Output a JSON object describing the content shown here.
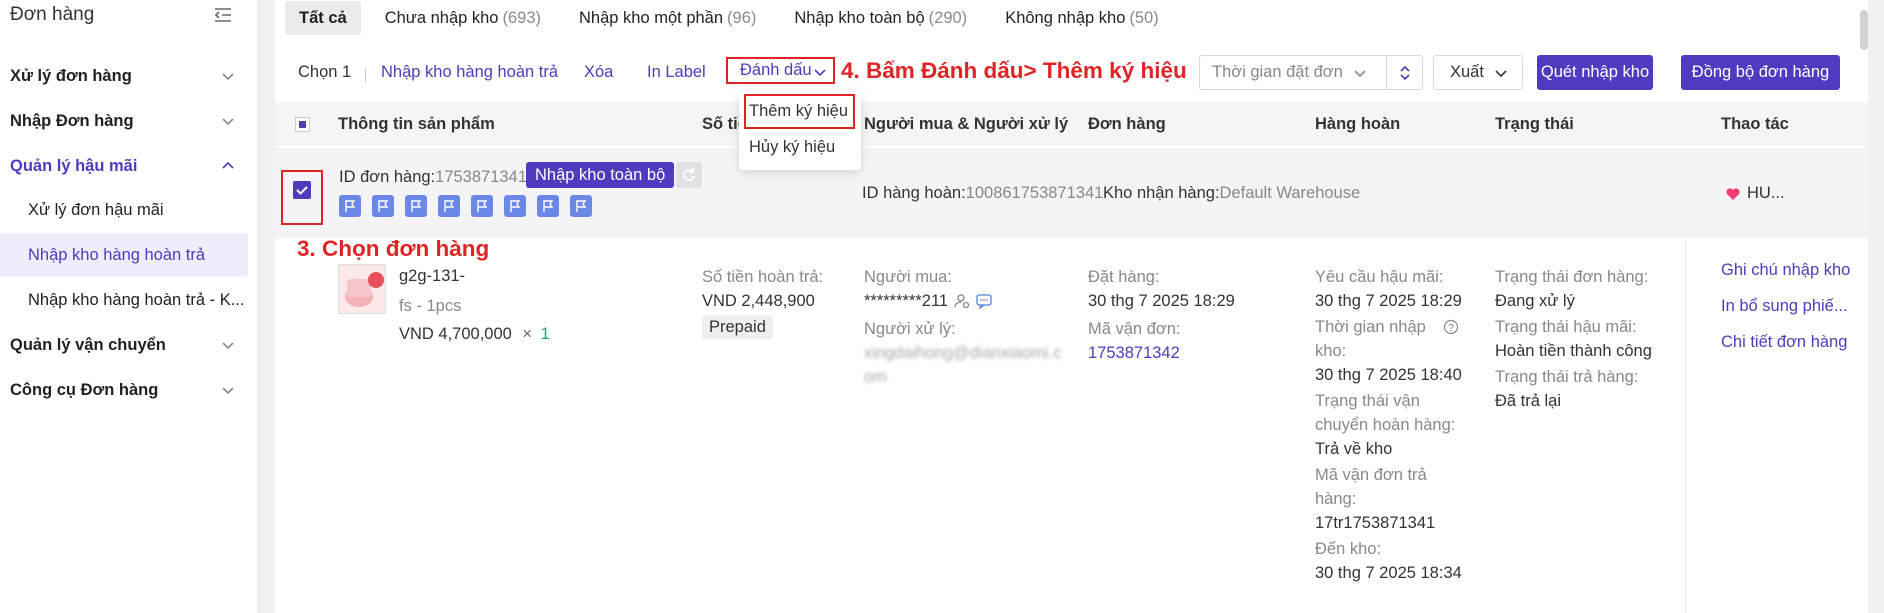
{
  "sidebar": {
    "title": "Đơn hàng",
    "items": [
      {
        "label": "Xử lý đơn hàng"
      },
      {
        "label": "Nhập Đơn hàng"
      },
      {
        "label": "Quản lý hậu mãi"
      },
      {
        "label": "Quản lý vận chuyển"
      },
      {
        "label": "Công cụ Đơn hàng"
      }
    ],
    "subitems": [
      {
        "label": "Xử lý đơn hậu mãi"
      },
      {
        "label": "Nhập kho hàng hoàn trả"
      },
      {
        "label": "Nhập kho hàng hoàn trả - K..."
      }
    ]
  },
  "tabs": [
    {
      "label": "Tất cả",
      "count": ""
    },
    {
      "label": "Chưa nhập kho",
      "count": "(693)"
    },
    {
      "label": "Nhập kho một phần",
      "count": "(96)"
    },
    {
      "label": "Nhập kho toàn bộ",
      "count": "(290)"
    },
    {
      "label": "Không nhập kho",
      "count": "(50)"
    }
  ],
  "actions": {
    "selected": "Chọn 1",
    "return_stock_in": "Nhập kho hàng hoàn trả",
    "delete": "Xóa",
    "print_label": "In Label",
    "mark": "Đánh dấu",
    "date_filter": "Thời gian đặt đơn",
    "export": "Xuất",
    "scan_stock_in": "Quét nhập kho",
    "sync_orders": "Đồng bộ đơn hàng"
  },
  "mark_menu": {
    "add": "Thêm ký hiệu",
    "remove": "Hủy ký hiệu"
  },
  "annotations": {
    "step4": "4. Bấm Đánh dấu> Thêm ký hiệu",
    "step3": "3. Chọn đơn hàng"
  },
  "columns": {
    "product": "Thông tin sản phẩm",
    "amount": "Số tiền",
    "buyer_handler": "Người mua & Người xử lý",
    "order": "Đơn hàng",
    "returned": "Hàng hoàn",
    "status": "Trạng thái",
    "actions": "Thao tác"
  },
  "order": {
    "id_label": "ID đơn hàng:",
    "id_value": "1753871341",
    "stock_badge": "Nhập kho toàn bộ",
    "return_id_label": "ID hàng hoàn:",
    "return_id_value": "100861753871341",
    "warehouse_label": "Kho nhận hàng:",
    "warehouse_value": "Default Warehouse",
    "shop": "HU...",
    "product_name": "g2g-131-",
    "product_variant": "fs - 1pcs",
    "product_price": "VND 4,700,000",
    "product_qty_x": "×",
    "product_qty": "1",
    "refund_label": "Số tiền hoàn trả:",
    "refund_value": "VND 2,448,900",
    "payment_tag": "Prepaid",
    "buyer_label": "Người mua:",
    "buyer_value": "*********211",
    "handler_label": "Người xử lý:",
    "handler_value": "xingdaihong@dianxiaomi.c",
    "handler_value2": "om",
    "order_date_label": "Đặt hàng:",
    "order_date_value": "30 thg 7 2025 18:29",
    "tracking_label": "Mã vận đơn:",
    "tracking_value": "1753871342",
    "aftersale_req_label": "Yêu cầu hậu mãi:",
    "aftersale_req_value": "30 thg 7 2025 18:29",
    "stockin_time_label_1": "Thời gian nhập",
    "stockin_time_label_2": "kho:",
    "stockin_time_value": "30 thg 7 2025 18:40",
    "return_ship_status_label_1": "Trạng thái vận",
    "return_ship_status_label_2": "chuyển hoàn hàng:",
    "return_ship_status_value": "Trả về kho",
    "return_tracking_label_1": "Mã vận đơn trả",
    "return_tracking_label_2": "hàng:",
    "return_tracking_value": "17tr1753871341",
    "arrive_label": "Đến kho:",
    "arrive_value": "30 thg 7 2025 18:34",
    "order_status_label": "Trạng thái đơn hàng:",
    "order_status_value": "Đang xử lý",
    "aftersale_status_label": "Trạng thái hậu mãi:",
    "aftersale_status_value": "Hoàn tiền thành công",
    "return_status_label": "Trạng thái trả hàng:",
    "return_status_value": "Đã trả lại",
    "op_note": "Ghi chú nhập kho",
    "op_supplement": "In bổ sung phiế...",
    "op_detail": "Chi tiết đơn hàng"
  },
  "colors": {
    "accent": "#4e3bbf",
    "annotation": "#e02424",
    "flag": "#6c88e6"
  }
}
